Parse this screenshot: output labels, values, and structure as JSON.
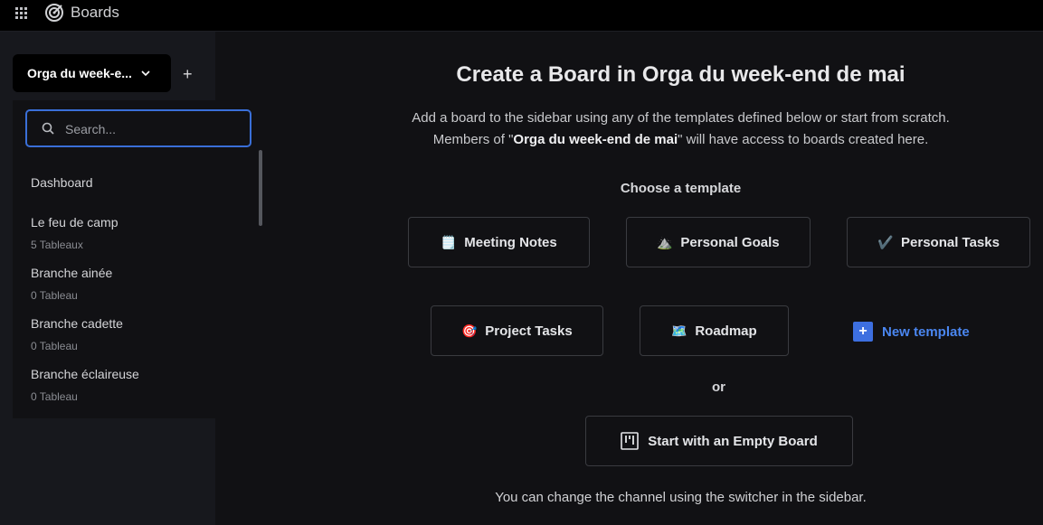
{
  "topbar": {
    "app_name": "Boards"
  },
  "sidebar": {
    "team_name": "Orga du week-e...",
    "add_label": "+",
    "search_placeholder": "Search...",
    "items": [
      {
        "title": "Dashboard",
        "subtitle": ""
      },
      {
        "title": "Le feu de camp",
        "subtitle": "5 Tableaux"
      },
      {
        "title": "Branche ainée",
        "subtitle": "0 Tableau"
      },
      {
        "title": "Branche cadette",
        "subtitle": "0 Tableau"
      },
      {
        "title": "Branche éclaireuse",
        "subtitle": "0 Tableau"
      }
    ]
  },
  "main": {
    "title": "Create a Board in Orga du week-end de mai",
    "desc_line1": "Add a board to the sidebar using any of the templates defined below or start from scratch.",
    "desc_line2_pre": "Members of \"",
    "desc_team": "Orga du week-end de mai",
    "desc_line2_post": "\" will have access to boards created here.",
    "choose_label": "Choose a template",
    "templates": [
      {
        "label": "Meeting Notes",
        "icon": "🗒️"
      },
      {
        "label": "Personal Goals",
        "icon": "⛰️"
      },
      {
        "label": "Personal Tasks",
        "icon": "✔️"
      },
      {
        "label": "Project Tasks",
        "icon": "🎯"
      },
      {
        "label": "Roadmap",
        "icon": "🗺️"
      }
    ],
    "new_template_label": "New template",
    "or_label": "or",
    "empty_board_label": "Start with an Empty Board",
    "hint": "You can change the channel using the switcher in the sidebar."
  },
  "colors": {
    "accent": "#3d6fe0",
    "background": "#111114",
    "sidebar": "#17181d"
  }
}
